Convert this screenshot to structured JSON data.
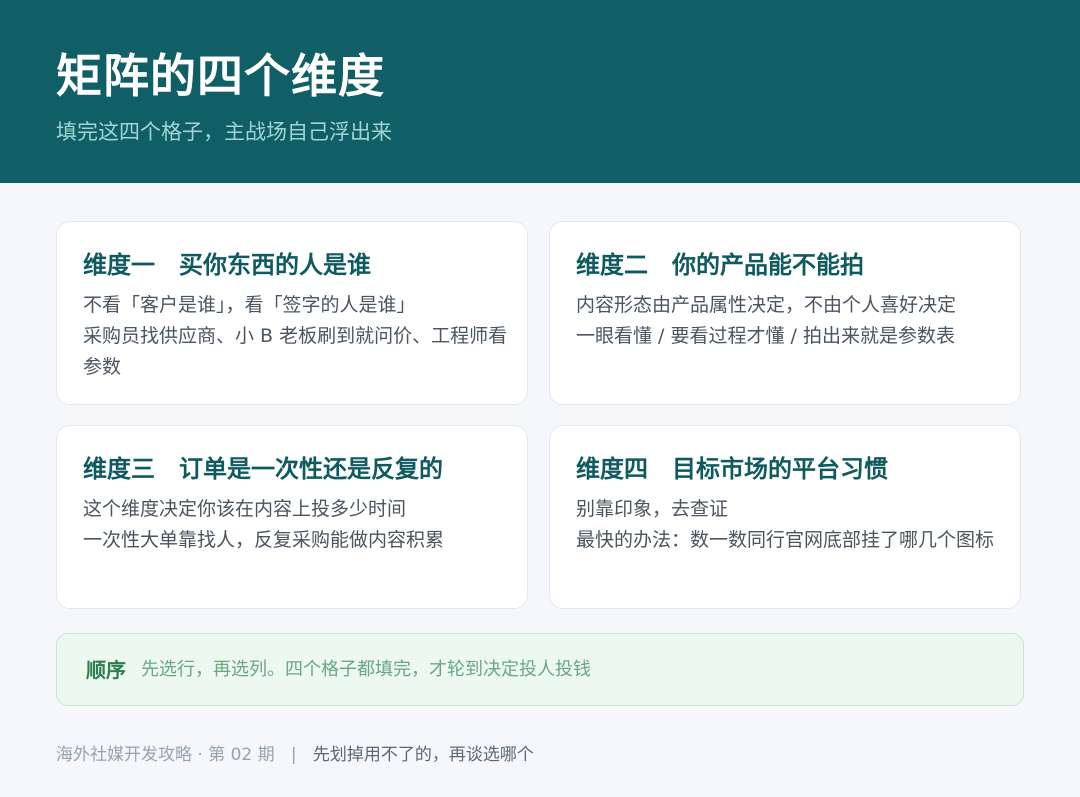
{
  "header": {
    "title": "矩阵的四个维度",
    "subtitle": "填完这四个格子，主战场自己浮出来"
  },
  "cards": [
    {
      "title": "维度一　买你东西的人是谁",
      "lines": [
        "不看「客户是谁」，看「签字的人是谁」",
        "采购员找供应商、小 B 老板刷到就问价、工程师看参数"
      ]
    },
    {
      "title": "维度二　你的产品能不能拍",
      "lines": [
        "内容形态由产品属性决定，不由个人喜好决定",
        "一眼看懂 / 要看过程才懂 / 拍出来就是参数表"
      ]
    },
    {
      "title": "维度三　订单是一次性还是反复的",
      "lines": [
        "这个维度决定你该在内容上投多少时间",
        "一次性大单靠找人，反复采购能做内容积累"
      ]
    },
    {
      "title": "维度四　目标市场的平台习惯",
      "lines": [
        "别靠印象，去查证",
        "最快的办法：数一数同行官网底部挂了哪几个图标"
      ]
    }
  ],
  "note": {
    "label": "顺序",
    "text": "先选行，再选列。四个格子都填完，才轮到决定投人投钱"
  },
  "footer": {
    "issue": "海外社媒开发攻略 · 第 02 期",
    "separator": "|",
    "tagline": "先划掉用不了的，再谈选哪个"
  },
  "colors": {
    "header_bg": "#105e66",
    "card_title": "#0f5a60",
    "note_bg": "#edf8f1",
    "note_label": "#2e7d4f"
  }
}
